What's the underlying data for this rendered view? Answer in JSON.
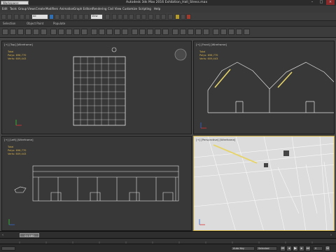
{
  "title_bar": {
    "workspace": "Workspace: Default",
    "app_title": "Autodesk 3ds Max 2016   Exhibition_Hall_Stress.max"
  },
  "menu": {
    "items": [
      "Edit",
      "Tools",
      "Group",
      "Views",
      "Create",
      "Modifiers",
      "Animation",
      "Graph Editors",
      "Rendering",
      "Civil View",
      "Customize",
      "Scripting",
      "Help"
    ],
    "search_placeholder": "Type a keyword or phrase"
  },
  "toolbar": {
    "filter_value": "All",
    "view_value": "View"
  },
  "ribbon": {
    "tabs": [
      "Selection",
      "Object Paint",
      "Populate"
    ]
  },
  "viewports": {
    "top": {
      "label": "[+] [Top] [Wireframe]"
    },
    "front": {
      "label": "[+] [Front] [Wireframe]"
    },
    "left": {
      "label": "[+] [Left] [Wireframe]"
    },
    "persp": {
      "label": "[+] [Perspective] [Wireframe]"
    },
    "stats_total": "Total",
    "stats_polys_label": "Polys:",
    "stats_polys": "696,770",
    "stats_verts_label": "Verts:",
    "stats_verts": "609,443"
  },
  "timeslider": {
    "frame_readout": "0 / 100",
    "progress": 0.0
  },
  "status": {
    "set_key": "Set Key",
    "auto_key": "Auto Key",
    "selected": "Selected",
    "frame": "0"
  },
  "colors": {
    "accent_yellow": "#d8b24b",
    "active_border": "#c9a93a"
  }
}
